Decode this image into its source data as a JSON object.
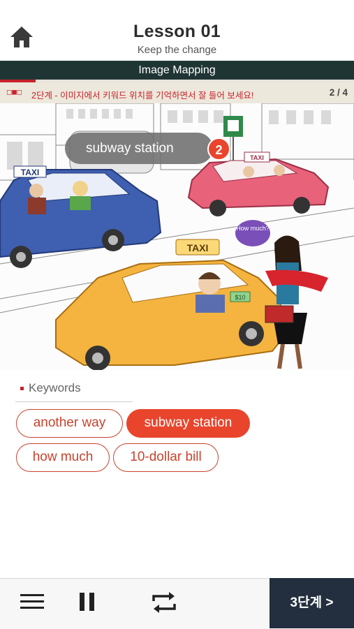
{
  "header": {
    "title": "Lesson 01",
    "subtitle": "Keep the change",
    "home_icon": "home-icon"
  },
  "mode_bar": {
    "label": "Image Mapping"
  },
  "progress": {
    "fraction": 0.1
  },
  "step_bar": {
    "icon": "step-indicator-icon",
    "message": "2단계 - 이미지에서 키워드 위치를 기억하면서 잘 들어 보세요!",
    "count": "2 / 4"
  },
  "scene": {
    "sign_taxi_1": "TAXI",
    "sign_taxi_2": "TAXI",
    "sign_taxi_3": "TAXI",
    "speech_bubble": "How much?",
    "bill_label": "$10",
    "tooltip": {
      "label": "subway station",
      "badge": "2"
    }
  },
  "keywords": {
    "heading": "Keywords",
    "items": [
      {
        "label": "another way",
        "active": false
      },
      {
        "label": "subway station",
        "active": true
      },
      {
        "label": "how much",
        "active": false
      },
      {
        "label": "10-dollar bill",
        "active": false
      }
    ]
  },
  "footer": {
    "menu_icon": "menu-icon",
    "pause_icon": "pause-icon",
    "repeat_icon": "repeat-icon",
    "next_label": "3단계  >"
  },
  "colors": {
    "accent": "#e8452c",
    "mode_bar": "#1f3534",
    "next_button": "#232f3e",
    "step_bar": "#ede8dc"
  }
}
